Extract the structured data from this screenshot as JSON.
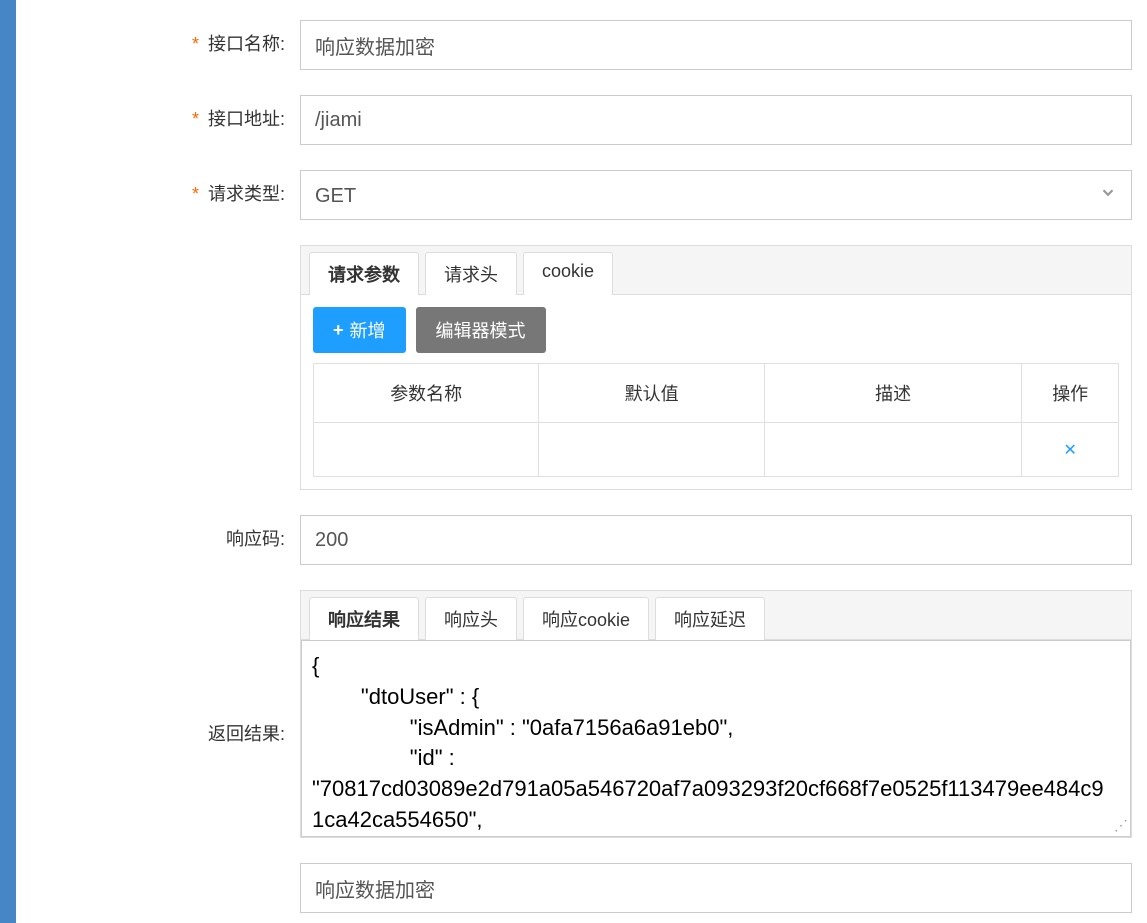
{
  "labels": {
    "interface_name": "接口名称:",
    "interface_url": "接口地址:",
    "request_type": "请求类型:",
    "response_code": "响应码:",
    "return_result": "返回结果:"
  },
  "values": {
    "interface_name": "响应数据加密",
    "interface_url": "/jiami",
    "request_type": "GET",
    "response_code": "200",
    "return_result": "{\n        \"dtoUser\" : {\n                \"isAdmin\" : \"0afa7156a6a91eb0\",\n                \"id\" : \"70817cd03089e2d791a05a546720af7a093293f20cf668f7e0525f113479ee484c91ca42ca554650\",",
    "bottom_field": "响应数据加密"
  },
  "tabs": {
    "request": {
      "params": "请求参数",
      "header": "请求头",
      "cookie": "cookie"
    },
    "response": {
      "result": "响应结果",
      "header": "响应头",
      "cookie": "响应cookie",
      "delay": "响应延迟"
    }
  },
  "buttons": {
    "add": "新增",
    "editor_mode": "编辑器模式"
  },
  "table": {
    "col_param_name": "参数名称",
    "col_default": "默认值",
    "col_desc": "描述",
    "col_action": "操作"
  }
}
